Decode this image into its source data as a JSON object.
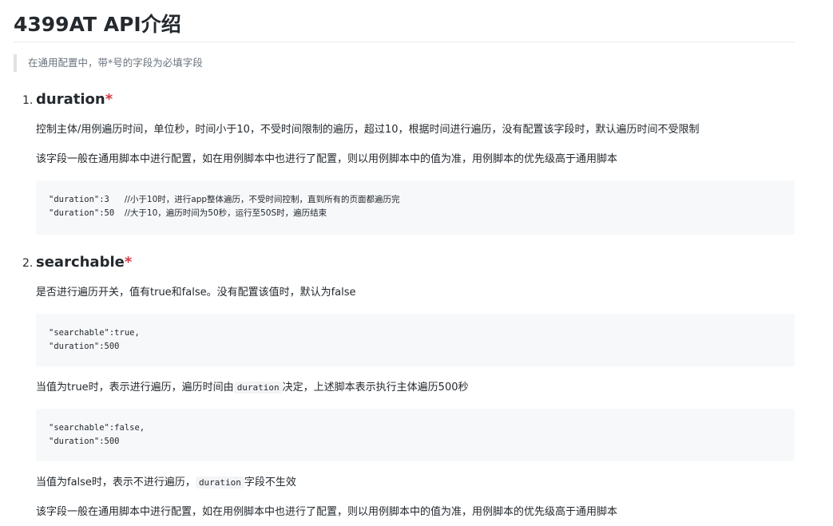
{
  "page_title": "4399AT API介绍",
  "note": "在通用配置中，带*号的字段为必填字段",
  "sections": [
    {
      "number": "1.",
      "heading": "duration",
      "required_mark": "*",
      "paragraphs": [
        "控制主体/用例遍历时间，单位秒，时间小于10，不受时间限制的遍历，超过10，根据时间进行遍历，没有配置该字段时，默认遍历时间不受限制",
        "该字段一般在通用脚本中进行配置，如在用例脚本中也进行了配置，则以用例脚本中的值为准，用例脚本的优先级高于通用脚本"
      ],
      "code_lines": [
        {
          "code": "\"duration\":3   ",
          "comment": "//小于10时，进行app整体遍历，不受时间控制，直到所有的页面都遍历完"
        },
        {
          "code": "\"duration\":50  ",
          "comment": "//大于10，遍历时间为50秒，运行至50S时，遍历结束"
        }
      ]
    },
    {
      "number": "2.",
      "heading": "searchable",
      "required_mark": "*",
      "intro": "是否进行遍历开关，值有true和false。没有配置该值时，默认为false",
      "code_block_1": [
        "\"searchable\":true,",
        "\"duration\":500"
      ],
      "desc_1": {
        "before": "当值为true时，表示进行遍历，遍历时间由",
        "inline_code": "duration",
        "after": "决定，上述脚本表示执行主体遍历500秒"
      },
      "code_block_2": [
        "\"searchable\":false,",
        "\"duration\":500"
      ],
      "desc_2": {
        "before": "当值为false时，表示不进行遍历，",
        "inline_code": "duration",
        "after": "字段不生效"
      },
      "note": "该字段一般在通用脚本中进行配置，如在用例脚本中也进行了配置，则以用例脚本中的值为准，用例脚本的优先级高于通用脚本"
    }
  ]
}
